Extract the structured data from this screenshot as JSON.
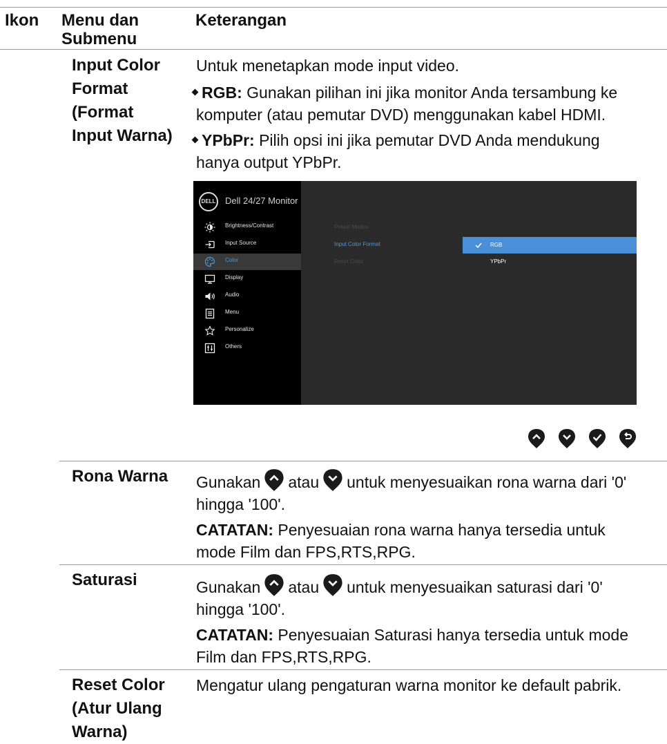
{
  "header": {
    "col_icon": "Ikon",
    "col_menu_line1": "Menu dan",
    "col_menu_line2": "Submenu",
    "col_desc": "Keterangan"
  },
  "rows": {
    "input_color_format": {
      "name_lines": [
        "Input Color",
        "Format",
        "(Format",
        "Input Warna)"
      ],
      "intro": "Untuk menetapkan mode input video.",
      "rgb_label": "RGB:",
      "rgb_text_line1": "Gunakan pilihan ini jika monitor Anda tersambung ke",
      "rgb_text_line2": "komputer (atau pemutar DVD) menggunakan kabel HDMI.",
      "ypbpr_label": "YPbPr:",
      "ypbpr_text_line1": "Pilih opsi ini jika pemutar DVD Anda mendukung",
      "ypbpr_text_line2": "hanya output YPbPr."
    },
    "rona_warna": {
      "name": "Rona Warna",
      "line1_a": "Gunakan",
      "line1_b": "atau",
      "line1_c": "untuk menyesuaikan rona warna dari '0'",
      "line2": "hingga '100'.",
      "note_label": "CATATAN:",
      "note_line1": "Penyesuaian rona warna hanya tersedia untuk",
      "note_line2": "mode Film dan FPS,RTS,RPG."
    },
    "saturasi": {
      "name": "Saturasi",
      "line1_a": "Gunakan",
      "line1_b": "atau",
      "line1_c": "untuk menyesuaikan saturasi dari '0'",
      "line2": "hingga '100'.",
      "note_label": "CATATAN:",
      "note_line1": "Penyesuaian Saturasi hanya tersedia untuk mode",
      "note_line2": "Film dan FPS,RTS,RPG."
    },
    "reset_color": {
      "name_lines": [
        "Reset Color",
        "(Atur Ulang",
        "Warna)"
      ],
      "desc": "Mengatur ulang pengaturan warna monitor ke default pabrik."
    }
  },
  "osd": {
    "logo": "DELL",
    "title": "Dell 24/27 Monitor",
    "menu": [
      {
        "label": "Brightness/Contrast",
        "icon": "brightness-icon"
      },
      {
        "label": "Input Source",
        "icon": "input-source-icon"
      },
      {
        "label": "Color",
        "icon": "color-palette-icon",
        "active": true
      },
      {
        "label": "Display",
        "icon": "display-icon"
      },
      {
        "label": "Audio",
        "icon": "speaker-icon"
      },
      {
        "label": "Menu",
        "icon": "menu-icon"
      },
      {
        "label": "Personalize",
        "icon": "star-icon"
      },
      {
        "label": "Others",
        "icon": "others-icon"
      }
    ],
    "options": [
      "Preset Modes",
      "Input Color Format",
      "Reset Color"
    ],
    "values": [
      "RGB",
      "YPbPr"
    ],
    "selected_value": "RGB",
    "accent_color": "#4a90d9"
  },
  "nav_buttons": [
    "chevron-up-icon",
    "chevron-down-icon",
    "check-icon",
    "back-icon"
  ]
}
